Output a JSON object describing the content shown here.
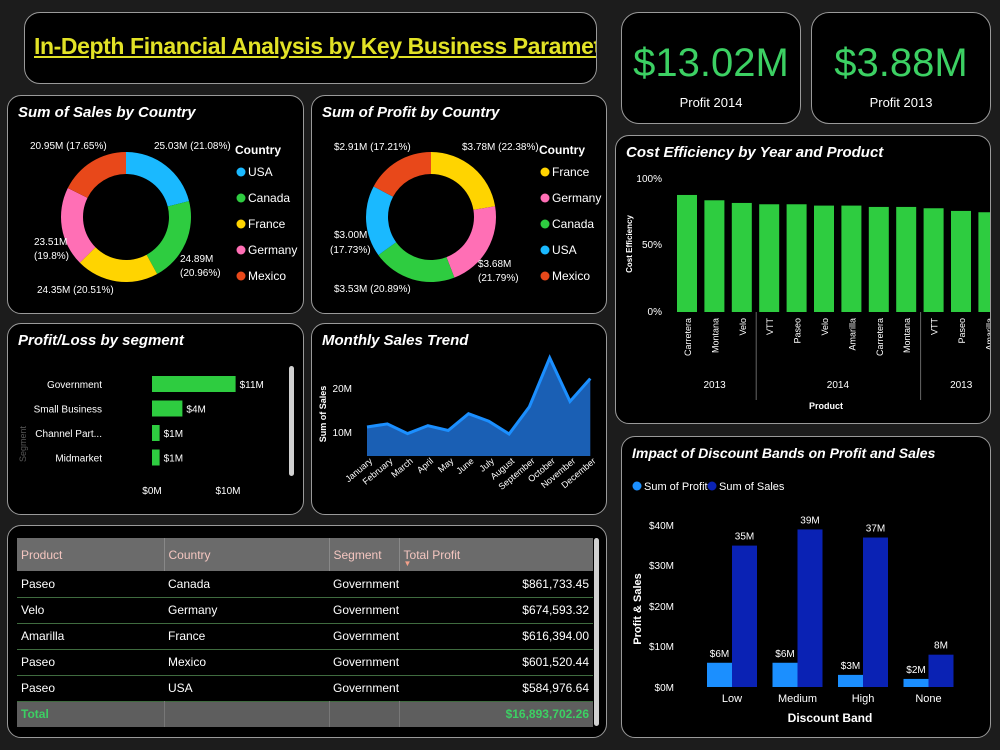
{
  "title": "In-Depth Financial Analysis by Key Business Parameters",
  "colors": {
    "accent_green": "#3cd063",
    "title_yellow": "#e2e226",
    "bar_green": "#2ecc40",
    "profit_blue": "#1b8fff",
    "sales_navy": "#0a22b4",
    "area_blue": "#1a5fb4",
    "usa": "#1ab9ff",
    "canada": "#2ecc40",
    "france": "#ffd400",
    "germany": "#ff6fb5",
    "mexico": "#e8481a"
  },
  "kpis": [
    {
      "value": "$13.02M",
      "label": "Profit 2014"
    },
    {
      "value": "$3.88M",
      "label": "Profit 2013"
    }
  ],
  "sales_by_country": {
    "title": "Sum of Sales by Country",
    "legend_title": "Country",
    "labels": {
      "usa": "25.03M (21.08%)",
      "canada_a": "24.89M",
      "canada_b": "(20.96%)",
      "france": "24.35M (20.51%)",
      "germany_a": "23.51M",
      "germany_b": "(19.8%)",
      "mexico": "20.95M (17.65%)"
    },
    "chart_data": {
      "type": "pie",
      "slices": [
        {
          "name": "USA",
          "value": 25.03,
          "percent": 21.08,
          "color": "#1ab9ff"
        },
        {
          "name": "Canada",
          "value": 24.89,
          "percent": 20.96,
          "color": "#2ecc40"
        },
        {
          "name": "France",
          "value": 24.35,
          "percent": 20.51,
          "color": "#ffd400"
        },
        {
          "name": "Germany",
          "value": 23.51,
          "percent": 19.8,
          "color": "#ff6fb5"
        },
        {
          "name": "Mexico",
          "value": 20.95,
          "percent": 17.65,
          "color": "#e8481a"
        }
      ]
    }
  },
  "profit_by_country": {
    "title": "Sum of Profit by Country",
    "legend_title": "Country",
    "labels": {
      "france": "$3.78M (22.38%)",
      "germany_a": "$3.68M",
      "germany_b": "(21.79%)",
      "canada": "$3.53M (20.89%)",
      "usa_a": "$3.00M",
      "usa_b": "(17.73%)",
      "mexico": "$2.91M (17.21%)"
    },
    "chart_data": {
      "type": "pie",
      "slices": [
        {
          "name": "France",
          "value": 3.78,
          "percent": 22.38,
          "color": "#ffd400"
        },
        {
          "name": "Germany",
          "value": 3.68,
          "percent": 21.79,
          "color": "#ff6fb5"
        },
        {
          "name": "Canada",
          "value": 3.53,
          "percent": 20.89,
          "color": "#2ecc40"
        },
        {
          "name": "USA",
          "value": 3.0,
          "percent": 17.73,
          "color": "#1ab9ff"
        },
        {
          "name": "Mexico",
          "value": 2.91,
          "percent": 17.21,
          "color": "#e8481a"
        }
      ]
    }
  },
  "profit_by_segment": {
    "title": "Profit/Loss by segment",
    "ylabel": "Segment",
    "ticks": [
      "$0M",
      "$10M"
    ],
    "chart_data": {
      "type": "bar",
      "orientation": "horizontal",
      "categories": [
        "Government",
        "Small Business",
        "Channel Part...",
        "Midmarket"
      ],
      "values": [
        11,
        4,
        1,
        1
      ],
      "data_labels": [
        "$11M",
        "$4M",
        "$1M",
        "$1M"
      ],
      "xlim": [
        0,
        11
      ]
    }
  },
  "monthly_sales": {
    "title": "Monthly Sales Trend",
    "ylabel": "Sum of Sales",
    "ticks": [
      "20M",
      "10M"
    ],
    "chart_data": {
      "type": "area",
      "categories": [
        "January",
        "February",
        "March",
        "April",
        "May",
        "June",
        "July",
        "August",
        "September",
        "October",
        "November",
        "December"
      ],
      "values": [
        6.6,
        7.3,
        5.1,
        6.9,
        5.8,
        9.6,
        7.9,
        5.0,
        11.2,
        22.3,
        12.4,
        17.6
      ],
      "ylim": [
        0,
        24
      ]
    }
  },
  "cost_efficiency": {
    "title": "Cost Efficiency by Year and Product",
    "ylabel": "Cost Efficiency",
    "xlabel": "Product",
    "ticks": [
      "100%",
      "50%",
      "0%"
    ],
    "chart_data": {
      "type": "bar",
      "categories": [
        "Carretera",
        "Montana",
        "Velo",
        "VTT",
        "Paseo",
        "Velo",
        "Amarilla",
        "Carretera",
        "Montana",
        "VTT",
        "Paseo",
        "Amarilla"
      ],
      "groups": [
        {
          "label": "2013",
          "count": 3
        },
        {
          "label": "2014",
          "count": 6
        },
        {
          "label": "2013",
          "count": 3
        }
      ],
      "values": [
        88,
        84,
        82,
        81,
        81,
        80,
        80,
        79,
        79,
        78,
        76,
        75
      ],
      "ylim": [
        0,
        100
      ]
    }
  },
  "discount_bands": {
    "title": "Impact of Discount Bands on Profit and Sales",
    "legend": [
      "Sum of Profit",
      "Sum of  Sales"
    ],
    "ylabel": "Profit & Sales",
    "xlabel": "Discount Band",
    "ticks": [
      "$40M",
      "$30M",
      "$20M",
      "$10M",
      "$0M"
    ],
    "chart_data": {
      "type": "bar",
      "categories": [
        "Low",
        "Medium",
        "High",
        "None"
      ],
      "series": [
        {
          "name": "Sum of Profit",
          "values": [
            6,
            6,
            3,
            2
          ],
          "labels": [
            "$6M",
            "$6M",
            "$3M",
            "$2M"
          ],
          "color": "#1b8fff"
        },
        {
          "name": "Sum of  Sales",
          "values": [
            35,
            39,
            37,
            8
          ],
          "labels": [
            "35M",
            "39M",
            "37M",
            "8M"
          ],
          "color": "#0a22b4"
        }
      ],
      "ylim": [
        0,
        40
      ]
    }
  },
  "profit_table": {
    "headers": [
      "Product",
      "Country",
      "Segment",
      "Total Profit"
    ],
    "rows": [
      [
        "Paseo",
        "Canada",
        "Government",
        "$861,733.45"
      ],
      [
        "Velo",
        "Germany",
        "Government",
        "$674,593.32"
      ],
      [
        "Amarilla",
        "France",
        "Government",
        "$616,394.00"
      ],
      [
        "Paseo",
        "Mexico",
        "Government",
        "$601,520.44"
      ],
      [
        "Paseo",
        "USA",
        "Government",
        "$584,976.64"
      ]
    ],
    "total_label": "Total",
    "total_value": "$16,893,702.26"
  }
}
